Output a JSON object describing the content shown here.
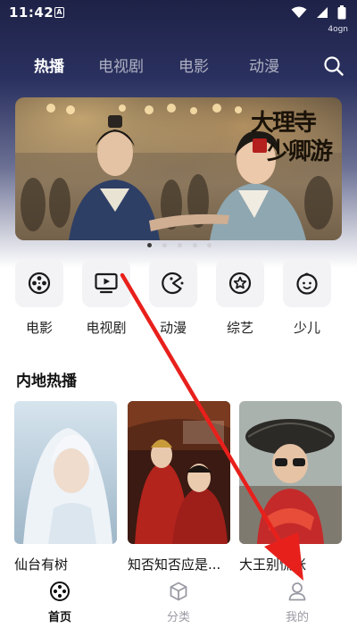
{
  "status_bar": {
    "time": "11:42",
    "notification_glyph": "A",
    "carrier_label": "4ogn",
    "icons": [
      "wifi-icon",
      "signal-icon",
      "battery-icon"
    ]
  },
  "top_nav": {
    "tabs": [
      {
        "label": "热播",
        "active": true
      },
      {
        "label": "电视剧",
        "active": false
      },
      {
        "label": "电影",
        "active": false
      },
      {
        "label": "动漫",
        "active": false
      }
    ],
    "search_icon": "search-icon"
  },
  "banner": {
    "logo_line1": "大理寺",
    "logo_line2": "少卿游",
    "slide_count": 5,
    "active_slide": 1
  },
  "categories": [
    {
      "label": "电影",
      "icon": "film-reel-icon"
    },
    {
      "label": "电视剧",
      "icon": "tv-play-icon"
    },
    {
      "label": "动漫",
      "icon": "pacman-icon"
    },
    {
      "label": "综艺",
      "icon": "star-badge-icon"
    },
    {
      "label": "少儿",
      "icon": "child-face-icon"
    }
  ],
  "section": {
    "title": "内地热播",
    "items": [
      {
        "title": "仙台有树"
      },
      {
        "title": "知否知否应是..."
      },
      {
        "title": "大王别慌张"
      }
    ]
  },
  "bottom_nav": {
    "items": [
      {
        "label": "首页",
        "icon": "home-reel-icon",
        "active": true
      },
      {
        "label": "分类",
        "icon": "cube-icon",
        "active": false
      },
      {
        "label": "我的",
        "icon": "profile-icon",
        "active": false
      }
    ]
  },
  "colors": {
    "header_dark": "#1e2247",
    "annotation_arrow": "#e8201c",
    "active_text": "#111111",
    "inactive_text": "#9a9aa4"
  }
}
